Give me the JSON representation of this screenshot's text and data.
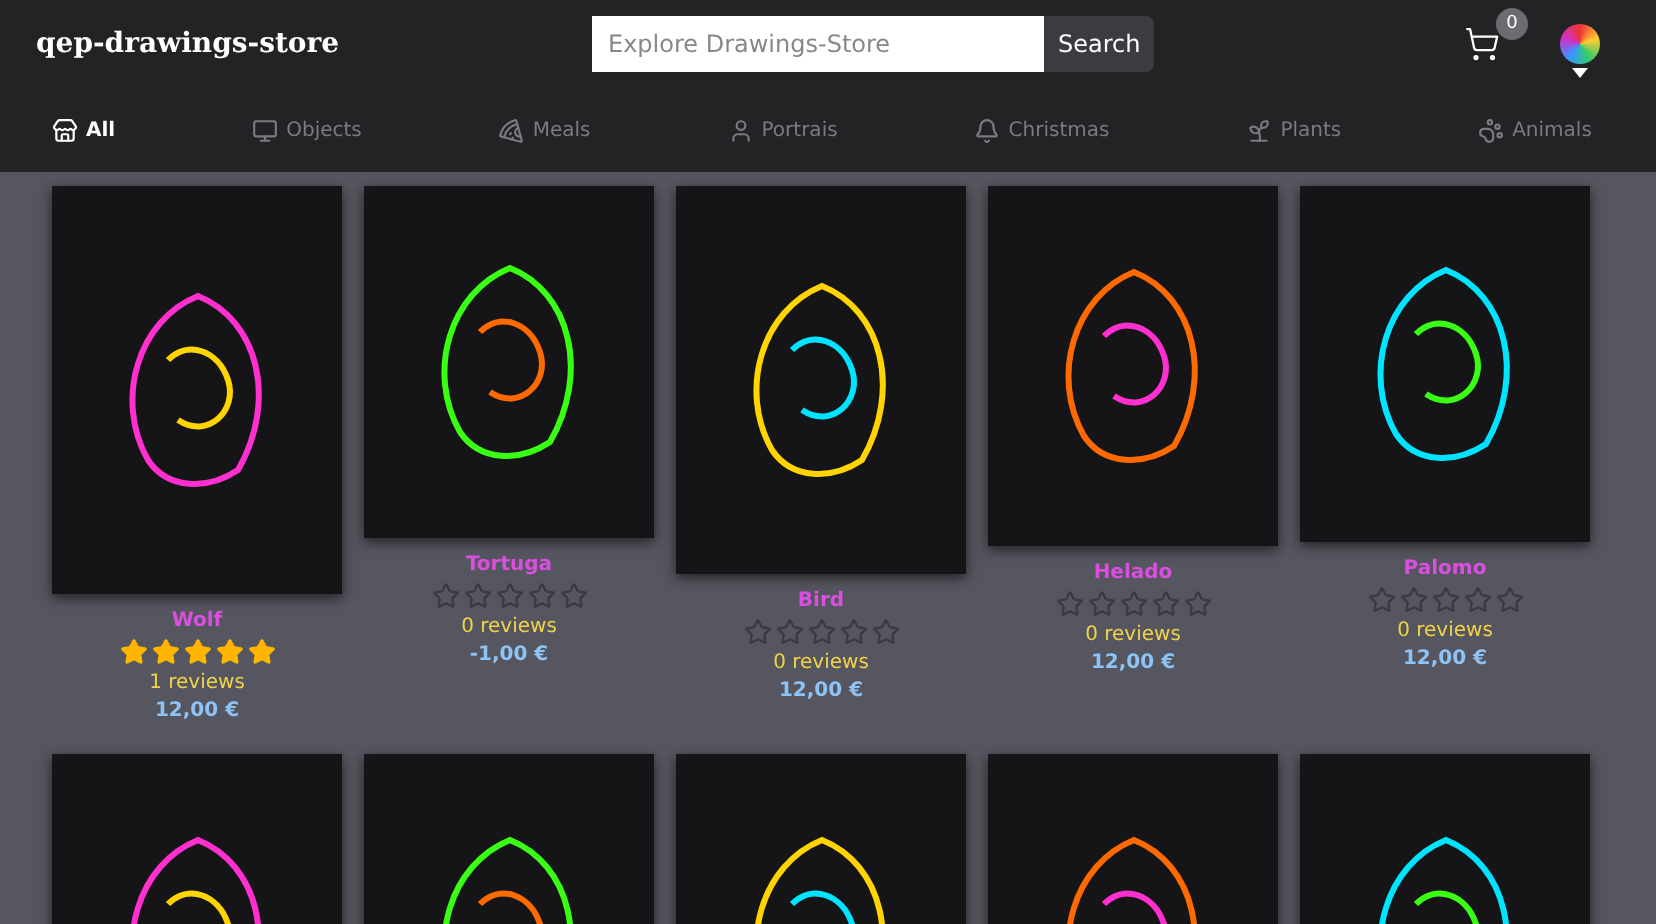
{
  "header": {
    "logo": "qep-drawings-store",
    "search": {
      "placeholder": "Explore Drawings-Store",
      "button": "Search"
    },
    "cart_count": "0"
  },
  "categories": [
    {
      "label": "All",
      "selected": true
    },
    {
      "label": "Objects",
      "selected": false
    },
    {
      "label": "Meals",
      "selected": false
    },
    {
      "label": "Portrais",
      "selected": false
    },
    {
      "label": "Christmas",
      "selected": false
    },
    {
      "label": "Plants",
      "selected": false
    },
    {
      "label": "Animals",
      "selected": false
    }
  ],
  "products": [
    {
      "kind": "full",
      "title": "Wolf",
      "stars": 5,
      "reviews": "1 reviews",
      "price": "12,00 €"
    },
    {
      "kind": "full",
      "title": "Tortuga",
      "stars": 0,
      "reviews": "0 reviews",
      "price": "-1,00 €"
    },
    {
      "kind": "full",
      "title": "Bird",
      "stars": 0,
      "reviews": "0 reviews",
      "price": "12,00 €"
    },
    {
      "kind": "full",
      "title": "Helado",
      "stars": 0,
      "reviews": "0 reviews",
      "price": "12,00 €"
    },
    {
      "kind": "full",
      "title": "Palomo",
      "stars": 0,
      "reviews": "0 reviews",
      "price": "12,00 €"
    },
    {
      "kind": "cropped"
    },
    {
      "kind": "cropped"
    },
    {
      "kind": "cropped"
    },
    {
      "kind": "cropped"
    },
    {
      "kind": "cropped"
    }
  ]
}
